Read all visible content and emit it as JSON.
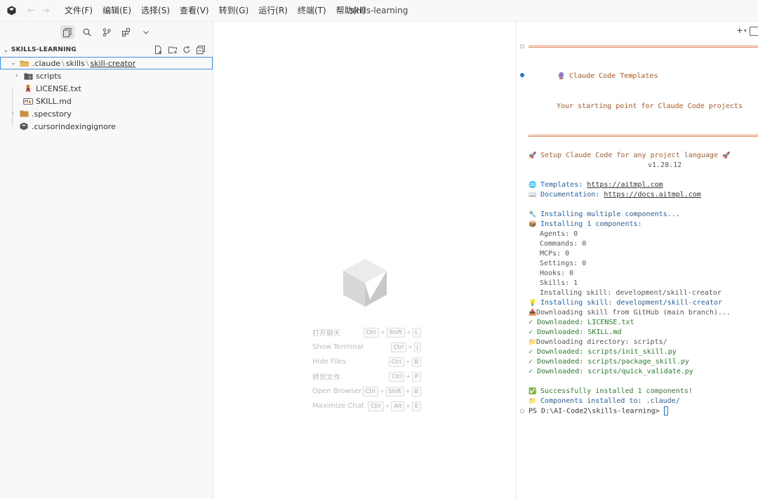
{
  "window": {
    "title": "skills-learning"
  },
  "menu": [
    "文件(F)",
    "编辑(E)",
    "选择(S)",
    "查看(V)",
    "转到(G)",
    "运行(R)",
    "终端(T)",
    "帮助(H)"
  ],
  "explorer": {
    "header": "SKILLS-LEARNING",
    "breadcrumb": [
      ".claude",
      "skills",
      "skill-creator"
    ],
    "items": [
      {
        "label": "scripts",
        "icon": "folder-gear-icon"
      },
      {
        "label": "LICENSE.txt",
        "icon": "license-icon"
      },
      {
        "label": "SKILL.md",
        "icon": "markdown-icon"
      },
      {
        "label": ".specstory",
        "icon": "folder-icon"
      },
      {
        "label": ".cursorindexingignore",
        "icon": "cube-icon"
      }
    ]
  },
  "editor": {
    "shortcuts": [
      {
        "label": "打开聊天",
        "keys": [
          "Ctrl",
          "Shift",
          "L"
        ]
      },
      {
        "label": "Show Terminal",
        "keys": [
          "Ctrl",
          "J"
        ]
      },
      {
        "label": "Hide Files",
        "keys": [
          "Ctrl",
          "B"
        ]
      },
      {
        "label": "转到文件",
        "keys": [
          "Ctrl",
          "P"
        ]
      },
      {
        "label": "Open Browser",
        "keys": [
          "Ctrl",
          "Shift",
          "B"
        ]
      },
      {
        "label": "Maximize Chat",
        "keys": [
          "Ctrl",
          "Alt",
          "E"
        ]
      }
    ]
  },
  "terminal": {
    "banner_title": "Claude Code Templates",
    "banner_subtitle": "Your starting point for Claude Code projects",
    "setup_line": "Setup Claude Code for any project language",
    "version": "v1.28.12",
    "templates_label": "Templates:",
    "templates_url": "https://aitmpl.com",
    "docs_label": "Documentation:",
    "docs_url": "https://docs.aitmpl.com",
    "installing_multiple": "Installing multiple components...",
    "installing_count": "Installing 1 components:",
    "counts": [
      "Agents: 0",
      "Commands: 0",
      "MCPs: 0",
      "Settings: 0",
      "Hooks: 0",
      "Skills: 1"
    ],
    "installing_skill_plain": "Installing skill: development/skill-creator",
    "installing_skill": "Installing skill: development/skill-creator",
    "downloading_skill": "Downloading skill from GitHub (main branch)...",
    "downloaded_license": "Downloaded: LICENSE.txt",
    "downloaded_skill": "Downloaded: SKILL.md",
    "downloading_dir": "Downloading directory: scripts/",
    "downloaded_init": "Downloaded: scripts/init_skill.py",
    "downloaded_package": "Downloaded: scripts/package_skill.py",
    "downloaded_validate": "Downloaded: scripts/quick_validate.py",
    "success": "Successfully installed 1 components!",
    "installed_to": "Components installed to: .claude/",
    "prompt": "PS D:\\AI-Code2\\skills-learning> "
  }
}
